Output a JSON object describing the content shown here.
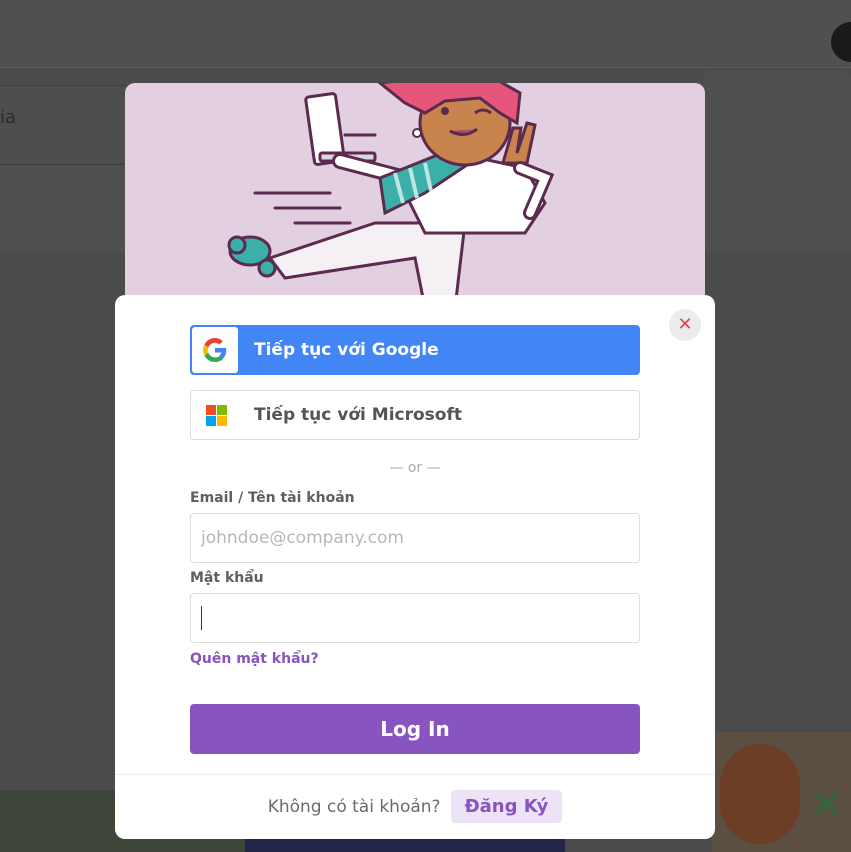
{
  "background": {
    "search_partial_text": "ia"
  },
  "modal": {
    "google_button_label": "Tiếp tục với Google",
    "microsoft_button_label": "Tiếp tục với Microsoft",
    "separator": "— or —",
    "email_label": "Email / Tên tài khoản",
    "email_placeholder": "johndoe@company.com",
    "email_value": "",
    "password_label": "Mật khẩu",
    "password_value": "",
    "forgot_password": "Quên mật khẩu?",
    "login_button": "Log In",
    "no_account_prompt": "Không có tài khoản?",
    "signup_button": "Đăng Ký",
    "close_icon": "close-icon"
  },
  "colors": {
    "accent_purple": "#8854c0",
    "google_blue": "#4285f4",
    "close_red": "#e0435e"
  }
}
